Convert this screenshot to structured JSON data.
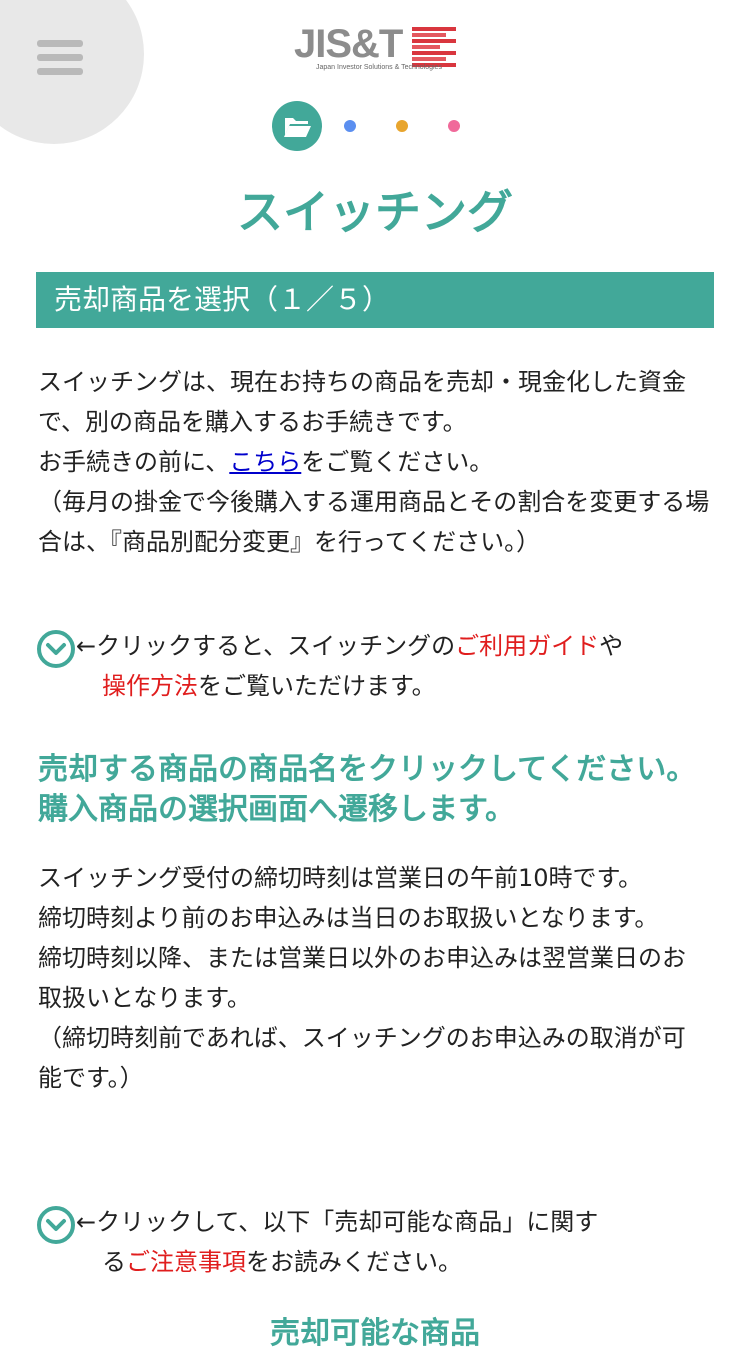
{
  "header": {
    "menu_icon": "hamburger-menu-icon",
    "logo": {
      "main": "JIS&T",
      "sub": "Japan Investor Solutions & Technologies"
    }
  },
  "steps": {
    "active_icon": "folder-open-icon",
    "dot_colors": [
      "#5b8ff0",
      "#e8a52e",
      "#f06a9a"
    ],
    "accent": "#42a899"
  },
  "page_title": "スイッチング",
  "section_title": "売却商品を選択（１／５）",
  "intro": {
    "line1": "スイッチングは、現在お持ちの商品を売却・現金化した資金で、別の商品を購入するお手続きです。",
    "line2_pre": "お手続きの前に、",
    "line2_link": "こちら",
    "line2_post": "をご覧ください。",
    "line3": "（毎月の掛金で今後購入する運用商品とその割合を変更する場合は、『商品別配分変更』を行ってください。）"
  },
  "guide_toggle": {
    "icon": "chevron-down-circle-icon",
    "pre": "←クリックすると、スイッチングの",
    "link1": "ご利用ガイド",
    "mid": "や",
    "link2": "操作方法",
    "post": "をご覧いただけます。"
  },
  "instruction": "売却する商品の商品名をクリックしてください。購入商品の選択画面へ遷移します。",
  "deadline": {
    "line1": "スイッチング受付の締切時刻は営業日の午前10時です。",
    "line2": "締切時刻より前のお申込みは当日のお取扱いとなります。",
    "line3": "締切時刻以降、または営業日以外のお申込みは翌営業日のお取扱いとなります。",
    "line4": "（締切時刻前であれば、スイッチングのお申込みの取消が可能です。）"
  },
  "notice_toggle": {
    "icon": "chevron-down-circle-icon",
    "pre": "←クリックして、以下「売却可能な商品」に関す",
    "pre2": "る",
    "link": "ご注意事項",
    "post": "をお読みください。"
  },
  "bottom_heading": "売却可能な商品"
}
